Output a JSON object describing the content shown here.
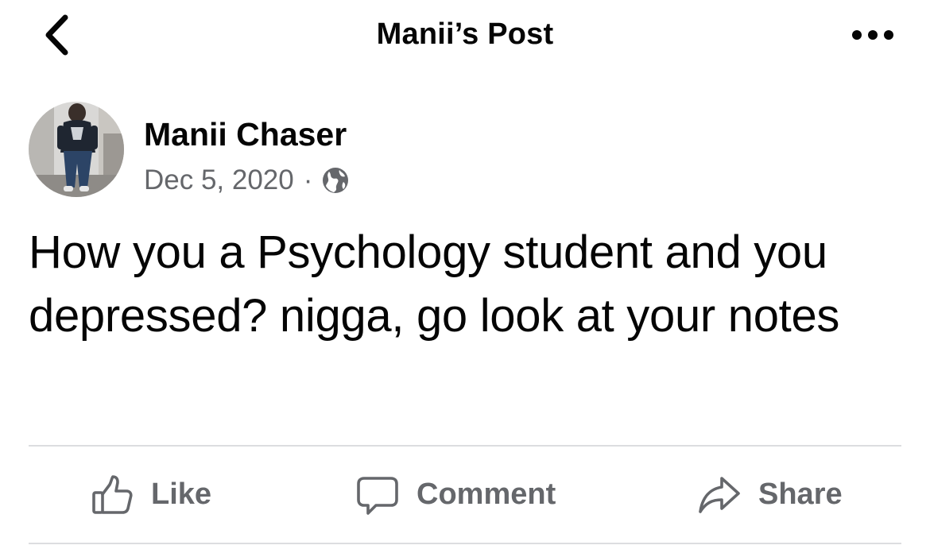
{
  "header": {
    "title": "Manii’s Post",
    "back_icon": "chevron-left-icon",
    "more_icon": "more-horizontal-icon"
  },
  "post": {
    "author": "Manii Chaser",
    "date": "Dec 5, 2020",
    "separator": "·",
    "privacy_icon": "globe-icon",
    "text": "How you a Psychology student and you depressed? nigga, go look at your notes"
  },
  "actions": {
    "like_label": "Like",
    "comment_label": "Comment",
    "share_label": "Share"
  },
  "colors": {
    "primary_text": "#050505",
    "secondary_text": "#65676b",
    "divider": "#dcdde0",
    "background": "#ffffff"
  }
}
